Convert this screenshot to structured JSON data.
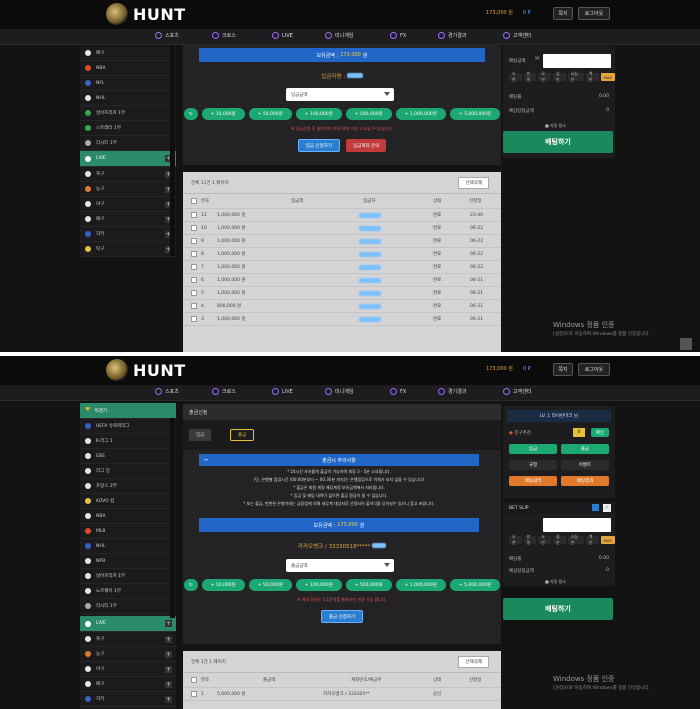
{
  "brand": {
    "name": "HUNT"
  },
  "header": {
    "money": "173,000 원",
    "points": "0 P",
    "btn_mypage": "쪽지",
    "btn_logout": "로그아웃"
  },
  "nav": [
    "스포츠",
    "크로스",
    "LIVE",
    "미니게임",
    "FX",
    "경기결과",
    "고객센터"
  ],
  "s1": {
    "left_items": [
      {
        "label": "배구",
        "color": "#e6e6e6"
      },
      {
        "label": "NBA",
        "color": "#e04a2a"
      },
      {
        "label": "NFL",
        "color": "#3760c8"
      },
      {
        "label": "NHL",
        "color": "#e6e6e6"
      },
      {
        "label": "살아프리카 1부",
        "color": "#3aa64a"
      },
      {
        "label": "스트레터 1부",
        "color": "#3aa64a"
      },
      {
        "label": "리시티 1부",
        "color": "#aaaaaa"
      }
    ],
    "live_label": "LIVE",
    "sports": [
      {
        "label": "축구",
        "color": "#e6e6e6"
      },
      {
        "label": "농구",
        "color": "#e07a2a"
      },
      {
        "label": "야구",
        "color": "#e6e6e6"
      },
      {
        "label": "배구",
        "color": "#e6e6e6"
      },
      {
        "label": "하키",
        "color": "#3760c8"
      },
      {
        "label": "탁구",
        "color": "#e6c23a"
      }
    ],
    "balance_label": "보유금액 :",
    "balance_value": "173,000",
    "balance_unit": "원",
    "deposit_holder_label": "입금자명 :",
    "deposit_select": "입금금액",
    "chips": [
      "+ 10,000원",
      "+ 50,000원",
      "+ 100,000원",
      "+ 500,000원",
      "+ 1,000,000원",
      "+ 5,000,000원"
    ],
    "notice": "※ 입금신청 후 충전까지 최대 30분 이상 소요될 수 있습니다.",
    "btn_apply": "입금 신청하기",
    "btn_account": "입금계좌 문의",
    "list_summary": "전체 11건 1 페이지",
    "history_btn": "선택삭제",
    "columns": [
      "번호",
      "입금액",
      "입금자",
      "상태",
      "신청일"
    ],
    "rows": [
      {
        "no": "11",
        "amount": "1,000,000 원",
        "status": "완료",
        "date": "23:40"
      },
      {
        "no": "10",
        "amount": "1,000,000 원",
        "status": "완료",
        "date": "06-22"
      },
      {
        "no": "9",
        "amount": "1,000,000 원",
        "status": "완료",
        "date": "06-22"
      },
      {
        "no": "8",
        "amount": "1,000,000 원",
        "status": "완료",
        "date": "06-22"
      },
      {
        "no": "7",
        "amount": "1,000,000 원",
        "status": "완료",
        "date": "06-22"
      },
      {
        "no": "6",
        "amount": "1,000,000 원",
        "status": "완료",
        "date": "06-21"
      },
      {
        "no": "5",
        "amount": "1,000,000 원",
        "status": "완료",
        "date": "06-21"
      },
      {
        "no": "4",
        "amount": "800,000 원",
        "status": "완료",
        "date": "06-21"
      },
      {
        "no": "3",
        "amount": "1,000,000 원",
        "status": "완료",
        "date": "06-21"
      }
    ],
    "betslip": {
      "amount_label": "배팅금액",
      "chips": [
        "오천",
        "만원",
        "오만",
        "십만",
        "오십만",
        "백만",
        "MAX"
      ],
      "odds_label": "배당률",
      "odds_value": "0.00",
      "expected_label": "예상당첨금액",
      "expected_value": "0",
      "autoclear": "■ 자동 청소",
      "bet_btn": "배팅하기"
    }
  },
  "s2": {
    "left_title": "빅경기",
    "left_items": [
      {
        "label": "UEFA 유로파리그",
        "color": "#3760c8"
      },
      {
        "label": "K-리그 1",
        "color": "#e6e6e6"
      },
      {
        "label": "EBS",
        "color": "#e6e6e6"
      },
      {
        "label": "리그 앙",
        "color": "#e6e6e6"
      },
      {
        "label": "프랑스 2부",
        "color": "#e6e6e6"
      },
      {
        "label": "KOVO 컵",
        "color": "#e6c23a"
      },
      {
        "label": "NBA",
        "color": "#e6e6e6"
      },
      {
        "label": "MLB",
        "color": "#e04a2a"
      },
      {
        "label": "NHL",
        "color": "#3760c8"
      },
      {
        "label": "NPB",
        "color": "#e6e6e6"
      },
      {
        "label": "살아프리카 1부",
        "color": "#e6e6e6"
      },
      {
        "label": "노르웨이 1부",
        "color": "#e6e6e6"
      },
      {
        "label": "리시티 1부",
        "color": "#aaaaaa"
      }
    ],
    "live_label": "LIVE",
    "sports": [
      {
        "label": "축구",
        "color": "#e6e6e6"
      },
      {
        "label": "농구",
        "color": "#e07a2a"
      },
      {
        "label": "야구",
        "color": "#e6e6e6"
      },
      {
        "label": "배구",
        "color": "#e6e6e6"
      },
      {
        "label": "하키",
        "color": "#3760c8"
      },
      {
        "label": "탁구",
        "color": "#e6c23a"
      }
    ],
    "page_title": "출금신청",
    "tab_deposit": "입금",
    "tab_withdraw": "출금",
    "notice_title": "출금시 주의사항",
    "notice_lines": [
      "* 24시간 자유롭게 출금이 가능하며 최장 3 - 5분 소요됩니다.",
      "(단, 은행별 점검시간 (00:00분부터 ~ 00:30분 까지)는 은행점검으로 이체가 되지 않을 수 있습니다)",
      "* 출금은 회원 계정 배당계정 보유금액에서 처리됩니다.",
      "* 입금 및 배팅 내역이 없으면 출금 환급이 될 수 없습니다.",
      "* 또는 출금, 번번한 은행거래는 금융법에 의해 세무계 대상처로 선정되어 불이익을 당하실수 있으니 참고 바랍니다."
    ],
    "balance_label": "보유금액 :",
    "balance_value": "173,000",
    "balance_unit": "원",
    "bank_line": "카카오뱅크 / 33330518*****",
    "withdraw_select": "출금금액",
    "chips": [
      "+ 10,000원",
      "+ 50,000원",
      "+ 100,000원",
      "+ 500,000원",
      "+ 1,000,000원",
      "+ 5,000,000원"
    ],
    "notice_small": "※ 계좌 정보는 1:1문의를 통해서만 변경 가능 합니다.",
    "btn_apply": "출금 신청하기",
    "list_summary": "전체 1건 1 페이지",
    "history_btn": "선택삭제",
    "columns": [
      "번호",
      "출금액",
      "계좌번호/예금주",
      "상태",
      "신청일"
    ],
    "row": {
      "no": "1",
      "amount": "5,000,000 원",
      "account": "카카오뱅크 / 333305**",
      "status": "승인",
      "date": ""
    },
    "user_line": "LV. 1  타이탄마크 님",
    "friend": "친구추천",
    "friend_count": "0",
    "friend_btn": "확인",
    "quick_buttons": [
      "입금",
      "출금",
      "규정",
      "이벤트",
      "배팅내역",
      "배팅결과"
    ],
    "betslip_title": "BET SLIP",
    "betslip": {
      "chips": [
        "오천",
        "만원",
        "오만",
        "십만",
        "오십만",
        "백만",
        "MAX"
      ],
      "odds_label": "배당률",
      "odds_value": "0.00",
      "expected_label": "예상당첨금액",
      "expected_value": "0",
      "autoclear": "■ 자동 청소",
      "bet_btn": "배팅하기"
    }
  },
  "windows": {
    "title": "Windows 정품 인증",
    "sub": "[설정]으로 이동하여 Windows를 정품 인증합니다."
  }
}
